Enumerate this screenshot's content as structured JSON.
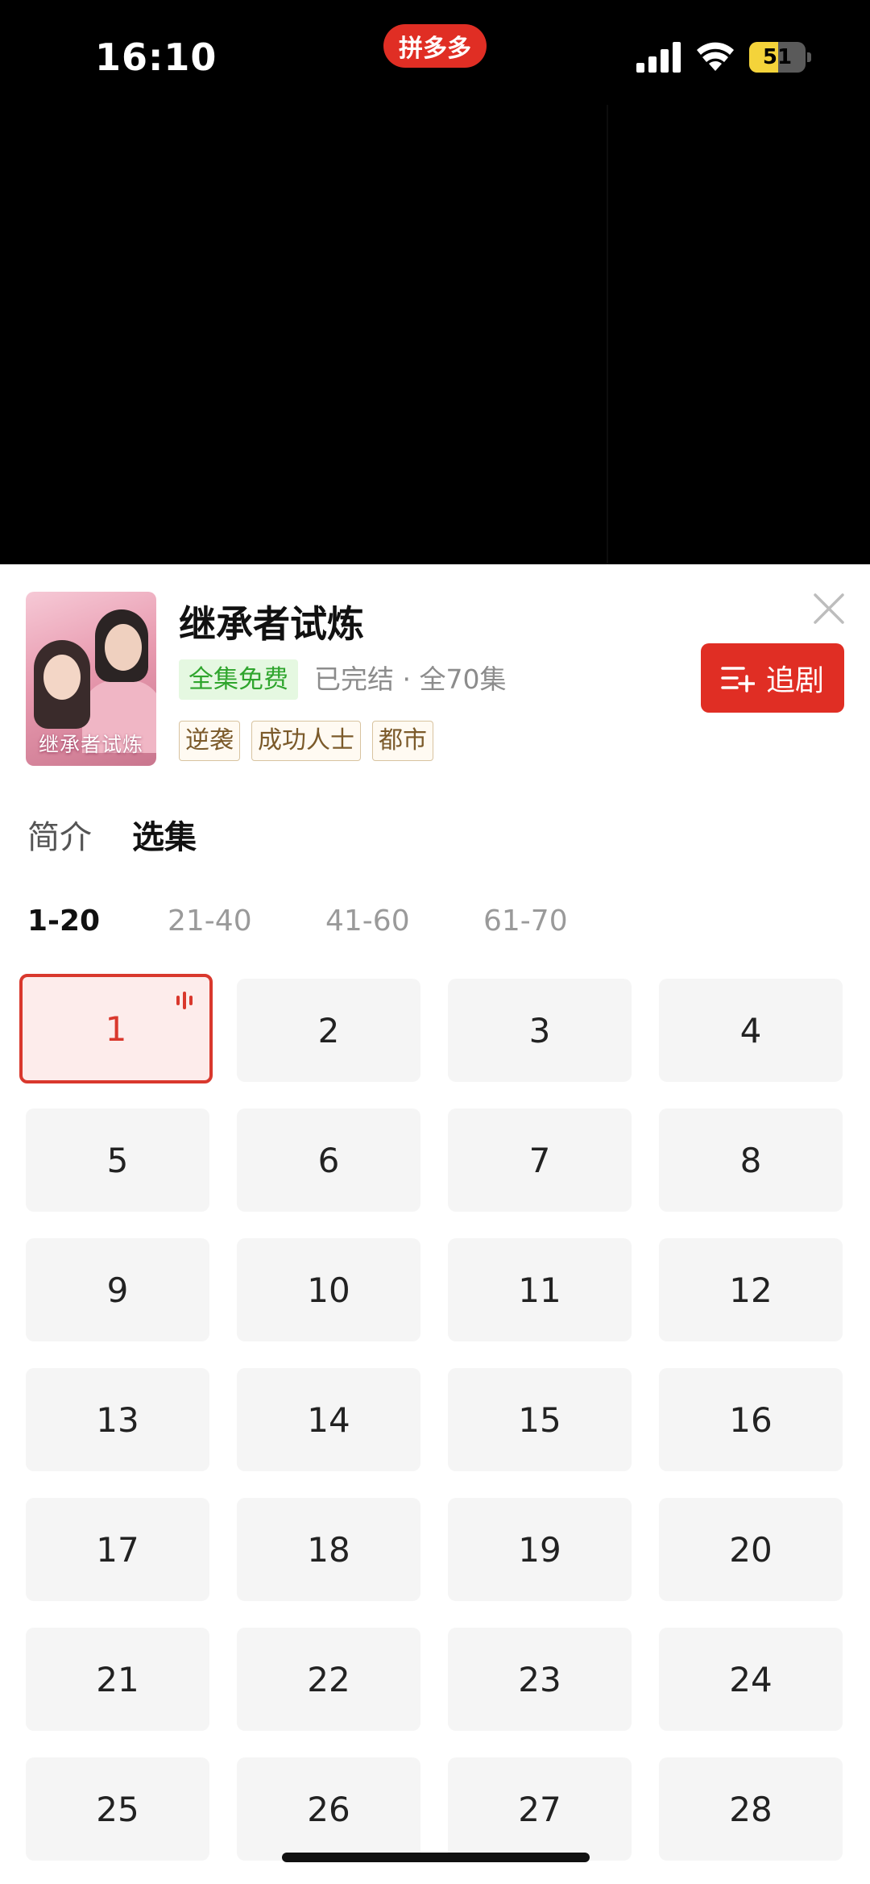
{
  "status_bar": {
    "time": "16:10",
    "app_badge": "拼多多",
    "battery": "51",
    "battery_level": 0.51
  },
  "drama": {
    "poster_text": "继承者试炼",
    "title": "继承者试炼",
    "free_badge": "全集免费",
    "status": "已完结 · 全70集",
    "tags": [
      "逆袭",
      "成功人士",
      "都市"
    ],
    "follow_label": "追剧"
  },
  "tabs": [
    {
      "label": "简介",
      "active": false
    },
    {
      "label": "选集",
      "active": true
    }
  ],
  "ranges": [
    {
      "label": "1-20",
      "active": true
    },
    {
      "label": "21-40",
      "active": false
    },
    {
      "label": "41-60",
      "active": false
    },
    {
      "label": "61-70",
      "active": false
    }
  ],
  "episodes": [
    "1",
    "2",
    "3",
    "4",
    "5",
    "6",
    "7",
    "8",
    "9",
    "10",
    "11",
    "12",
    "13",
    "14",
    "15",
    "16",
    "17",
    "18",
    "19",
    "20",
    "21",
    "22",
    "23",
    "24",
    "25",
    "26",
    "27",
    "28"
  ],
  "current_episode": "1",
  "colors": {
    "accent": "#e02e24",
    "free_green": "#2fa52d",
    "tag_brown": "#7b5a2a"
  }
}
